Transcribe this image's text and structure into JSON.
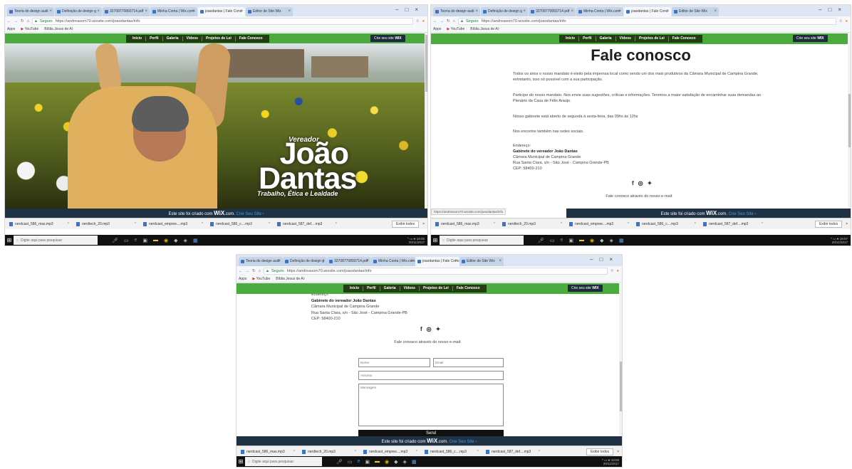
{
  "browser": {
    "tabs": [
      "Teoria do design audi",
      "Definição de design g",
      "32708770893714.pdf",
      "Minha Conta | Wix.com",
      "joaodantas | Fale Cono",
      "Editor de Site Wix"
    ],
    "url_secure_label": "Seguro",
    "url": "https://andreasom70.wixsite.com/joaodantas/info",
    "bookmarks": [
      "Apps",
      "YouTube",
      "Bíblia Jesus de Al·"
    ]
  },
  "site": {
    "menu": [
      "Início",
      "Perfil",
      "Galeria",
      "Vídeos",
      "Projetos de Lei",
      "Fale Conosco"
    ],
    "create_button": "Crie seu site",
    "create_logo": "WIX",
    "hero": {
      "title_small": "Vereador",
      "name_line1": "João",
      "name_line2": "Dantas",
      "motto": "Trabalho, Ética e Lealdade"
    },
    "contact": {
      "title": "Fale conosco",
      "p1": "Todos os anos o nosso mandato é eleito pela imprensa local como sendo um dos mais produtivos da Câmara Municipal de Campina Grande, entretanto, isso só possível com a sua participação.",
      "p2": "Participe do nosso mandato. Nos envie suas sugestões, críticas e informações. Teremos a maior satisfação de encaminhar suas demandas ao Plenário da Casa de Félix Araújo.",
      "p3": "Nosso gabinete está aberto de segunda à sexta-feira, das 09hs às 12hs",
      "p4": "Nos encontre também nas redes sociais.",
      "address_label": "Endereço:",
      "office": "Gabinete do vereador João Dantas",
      "chamber": "Câmara Municipal de Campina Grande",
      "street": "Rua Santa Clara, s/n - São José - Campina Grande-PB",
      "cep": "CEP: 58400-210",
      "social_icons": [
        "facebook-icon",
        "instagram-icon",
        "twitter-icon"
      ],
      "form_line": "Fale conosco através do nosso e-mail:",
      "name_ph": "Nome",
      "email_ph": "Email",
      "subject_ph": "Assunto",
      "message_ph": "Mensagem",
      "send": "Send"
    },
    "wix_banner": {
      "prefix": "Este site foi criado com",
      "brand": "WiX",
      "suffix": ".com.",
      "cta": "Crie Seu Site ›"
    },
    "status_url": "https://andreasom70.wixsite.com/joaodantas/info"
  },
  "downloads": {
    "items": [
      "nerdcast_586_mas.mp3",
      "nerdtech_20.mp3",
      "nerdcast_empree....mp3",
      "nerdcast_586_c....mp3",
      "nerdcast_587_def....mp3"
    ],
    "show_all": "Exibir todos"
  },
  "taskbar": {
    "search_ph": "Digite aqui para pesquisar",
    "times": [
      "18:06",
      "18:07",
      "18:08"
    ],
    "date": "20/11/2017"
  }
}
